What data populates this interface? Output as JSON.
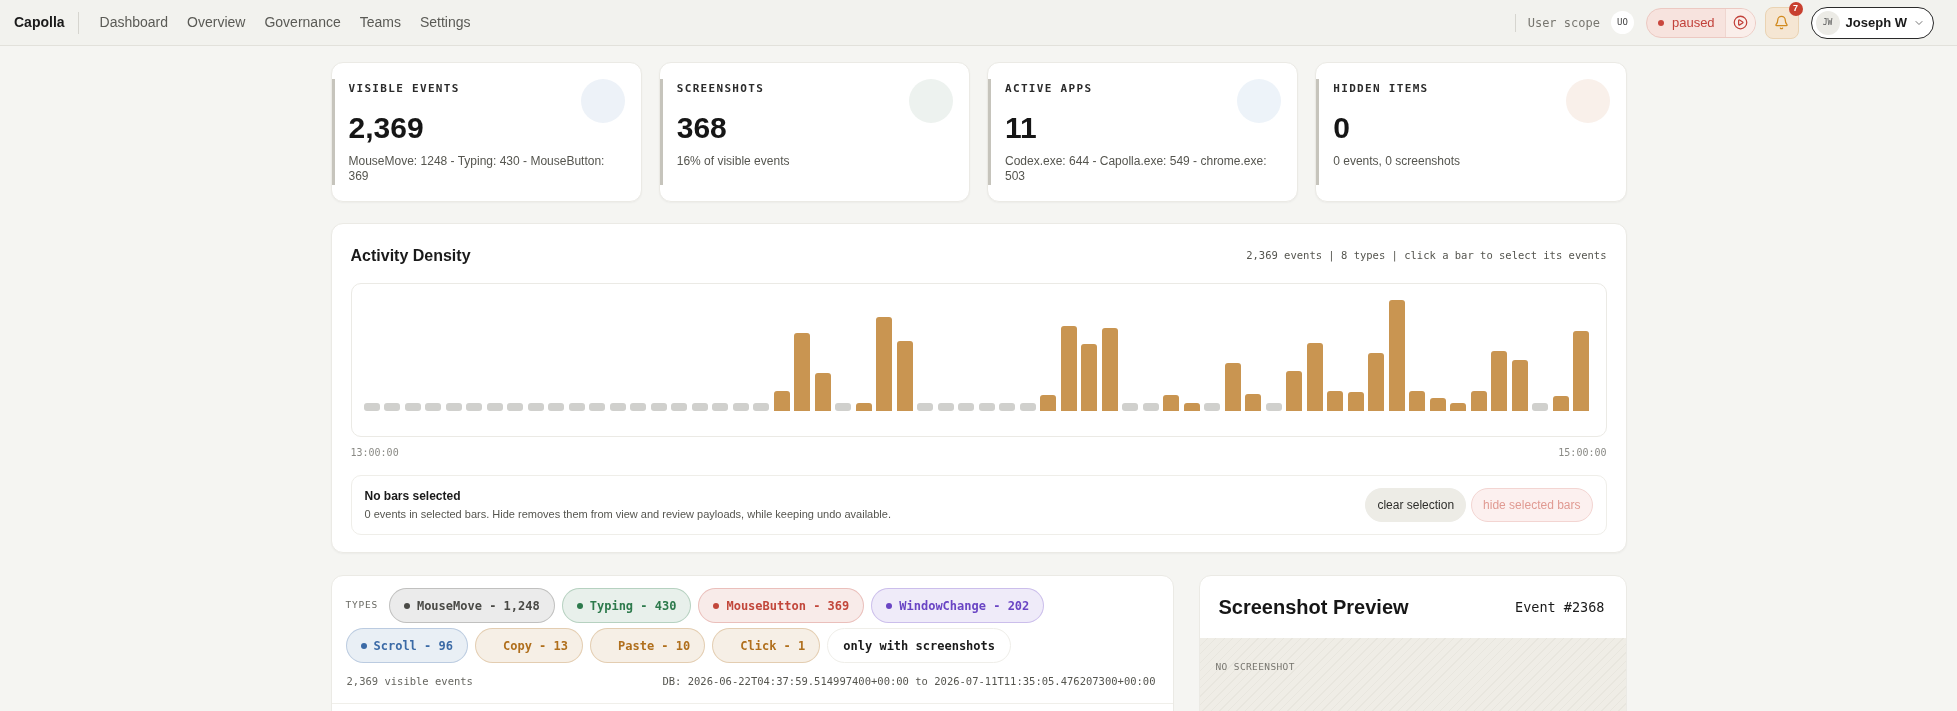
{
  "header": {
    "brand": "Capolla",
    "nav": [
      {
        "label": "Dashboard"
      },
      {
        "label": "Overview"
      },
      {
        "label": "Governance"
      },
      {
        "label": "Teams"
      },
      {
        "label": "Settings"
      }
    ],
    "scope_label": "User scope",
    "scope_badge": "UO",
    "status": "paused",
    "notifications": "7",
    "user": {
      "initials": "JW",
      "name": "Joseph W"
    }
  },
  "stats": [
    {
      "label": "VISIBLE EVENTS",
      "value": "2,369",
      "detail": "MouseMove: 1248 - Typing: 430 - MouseButton: 369",
      "color": "#edf2f8"
    },
    {
      "label": "SCREENSHOTS",
      "value": "368",
      "detail": "16% of visible events",
      "color": "#edf2ef"
    },
    {
      "label": "ACTIVE APPS",
      "value": "11",
      "detail": "Codex.exe: 644 - Capolla.exe: 549 - chrome.exe: 503",
      "color": "#edf3f9"
    },
    {
      "label": "HIDDEN ITEMS",
      "value": "0",
      "detail": "0 events, 0 screenshots",
      "color": "#f9f0ea"
    }
  ],
  "density": {
    "title": "Activity Density",
    "meta": "2,369 events | 8 types | click a bar to select its events",
    "x_start": "13:00:00",
    "x_end": "15:00:00",
    "selection": {
      "title": "No bars selected",
      "text": "0 events in selected bars. Hide removes them from view and review payloads, while keeping undo available."
    },
    "buttons": [
      {
        "label": "clear selection",
        "kind": "neutral",
        "disabled": false
      },
      {
        "label": "hide selected bars",
        "kind": "danger",
        "disabled": true
      }
    ]
  },
  "types": {
    "label": "TYPES",
    "chips": [
      {
        "label": "MouseMove - 1,248",
        "color": "#4a4a46",
        "dot": true,
        "selected": true
      },
      {
        "label": "Typing - 430",
        "color": "#2d7a4c",
        "dot": true,
        "selected": true
      },
      {
        "label": "MouseButton - 369",
        "color": "#c2473b",
        "dot": true,
        "selected": true
      },
      {
        "label": "WindowChange - 202",
        "color": "#6a45c4",
        "dot": true,
        "selected": true
      },
      {
        "label": "Scroll - 96",
        "color": "#3b6aa6",
        "dot": true,
        "selected": true
      },
      {
        "label": "Copy - 13",
        "color": "#b06f1d",
        "dot": false,
        "selected": true
      },
      {
        "label": "Paste - 10",
        "color": "#b06f1d",
        "dot": false,
        "selected": true
      },
      {
        "label": "Click - 1",
        "color": "#b06f1d",
        "dot": false,
        "selected": true
      }
    ],
    "toggle": {
      "label": "only with screenshots",
      "on": false
    },
    "count": "2,369 visible events",
    "range": "DB: 2026-06-22T04:37:59.514997400+00:00 to 2026-07-11T11:35:05.476207300+00:00"
  },
  "preview": {
    "title": "Screenshot Preview",
    "event": "Event #2368",
    "empty": "NO SCREENSHOT"
  }
}
